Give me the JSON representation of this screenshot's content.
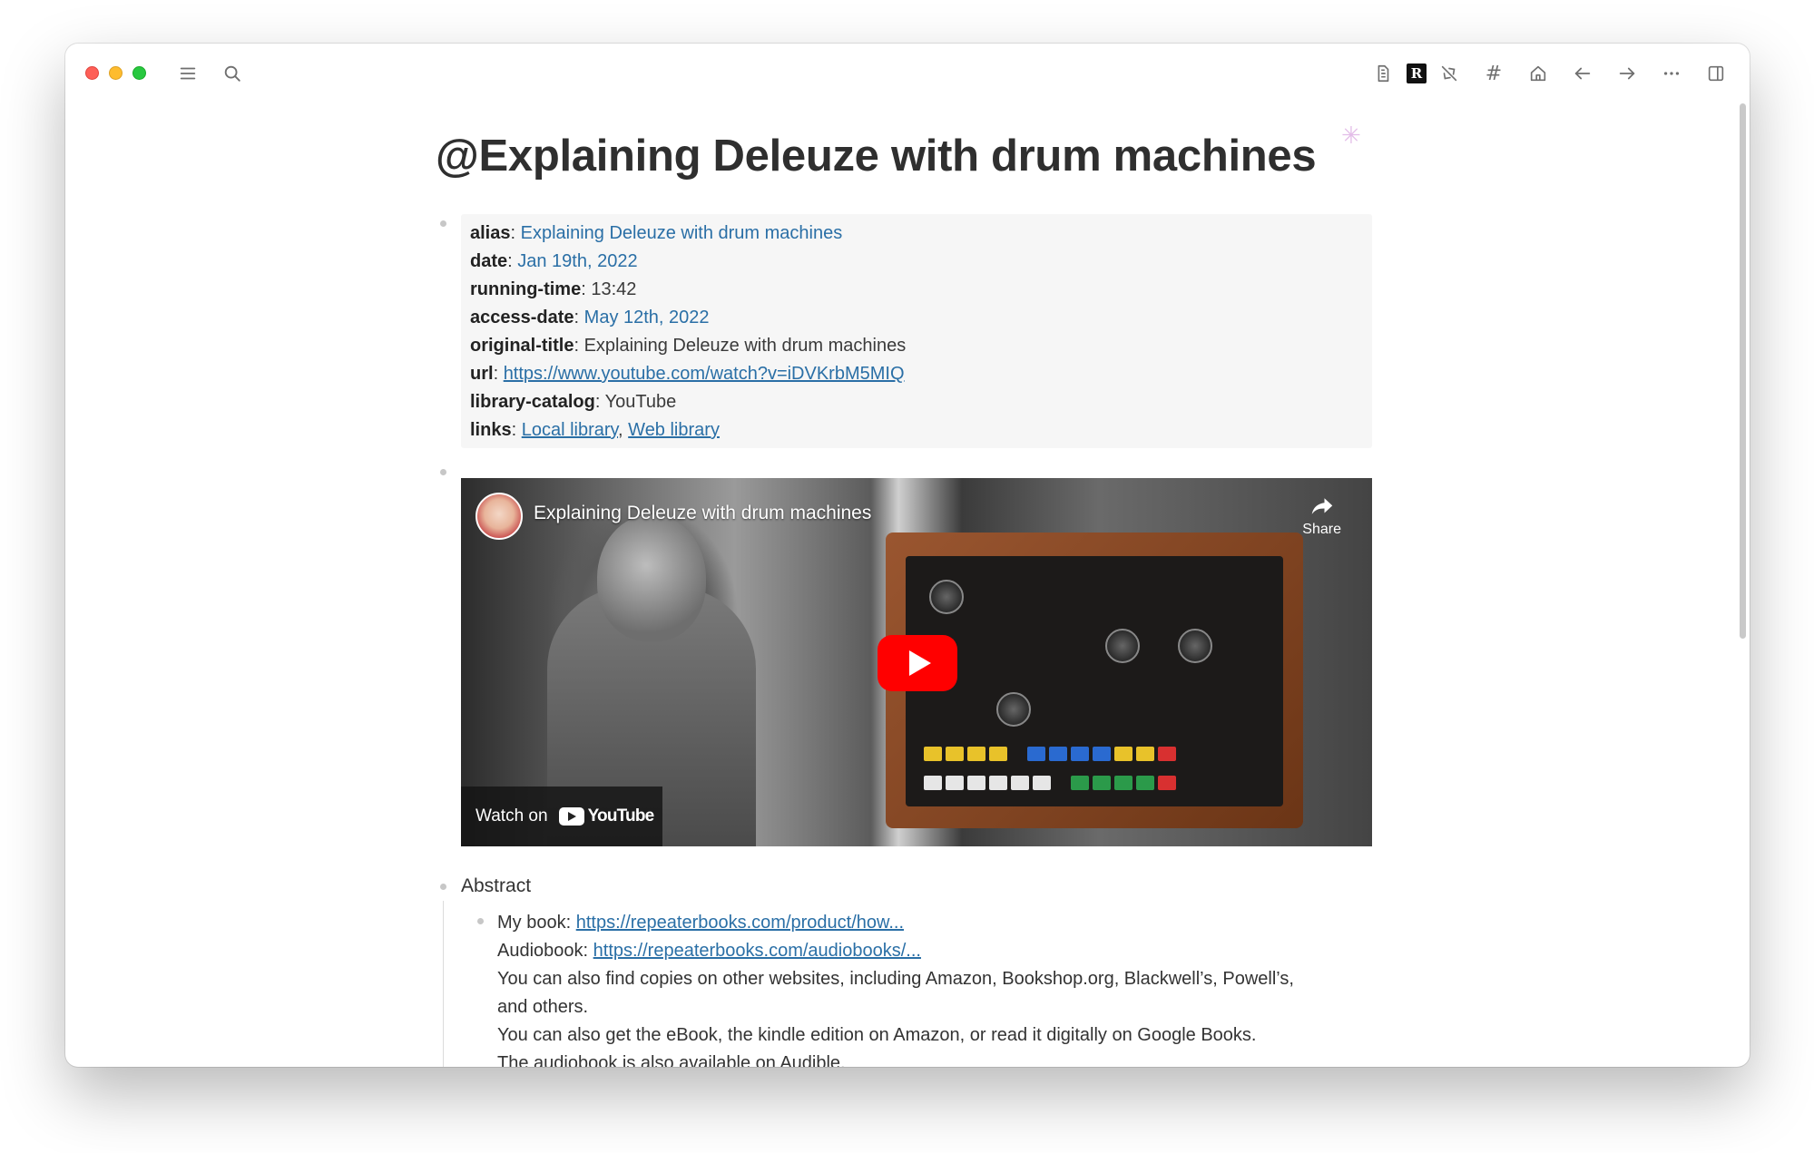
{
  "toolbar": {
    "left_icons": [
      "menu-icon",
      "search-icon"
    ],
    "right_icons": [
      "document-icon",
      "r-logo-icon",
      "puzzle-icon",
      "hash-icon",
      "home-icon",
      "back-arrow-icon",
      "forward-arrow-icon",
      "more-icon",
      "sidebar-toggle-icon"
    ],
    "r_logo_text": "R",
    "hash_text": "#"
  },
  "page": {
    "title": "@Explaining Deleuze with drum machines",
    "sparkle": "✳"
  },
  "properties": {
    "alias": {
      "key": "alias",
      "value": "Explaining Deleuze with drum machines"
    },
    "date": {
      "key": "date",
      "value": "Jan 19th, 2022"
    },
    "running_time": {
      "key": "running-time",
      "value": "13:42"
    },
    "access_date": {
      "key": "access-date",
      "value": "May 12th, 2022"
    },
    "original_title": {
      "key": "original-title",
      "value": "Explaining Deleuze with drum machines"
    },
    "url": {
      "key": "url",
      "value": "https://www.youtube.com/watch?v=iDVKrbM5MIQ"
    },
    "library_catalog": {
      "key": "library-catalog",
      "value": "YouTube"
    },
    "links": {
      "key": "links",
      "local": "Local library",
      "separator": ",",
      "web": "Web library"
    }
  },
  "video": {
    "title": "Explaining Deleuze with drum machines",
    "share_label": "Share",
    "watch_on": "Watch on",
    "youtube": "YouTube",
    "colors": {
      "play": "#ff0000"
    }
  },
  "abstract": {
    "label": "Abstract",
    "book_prefix": "My book:",
    "book_link": "https://repeaterbooks.com/product/how...",
    "audiobook_prefix": "Audiobook:",
    "audiobook_link": "https://repeaterbooks.com/audiobooks/...",
    "line3": "You can also find copies on other websites, including Amazon, Bookshop.org, Blackwell’s, Powell’s,",
    "line4": "and others.",
    "line5": "You can also get the eBook, the kindle edition on Amazon, or read it digitally on Google Books.",
    "line6": "The audiobook is also available on Audible."
  },
  "colors": {
    "link": "#2a6fa6",
    "title": "#2f2f2f",
    "property_bg": "#f6f6f6"
  }
}
